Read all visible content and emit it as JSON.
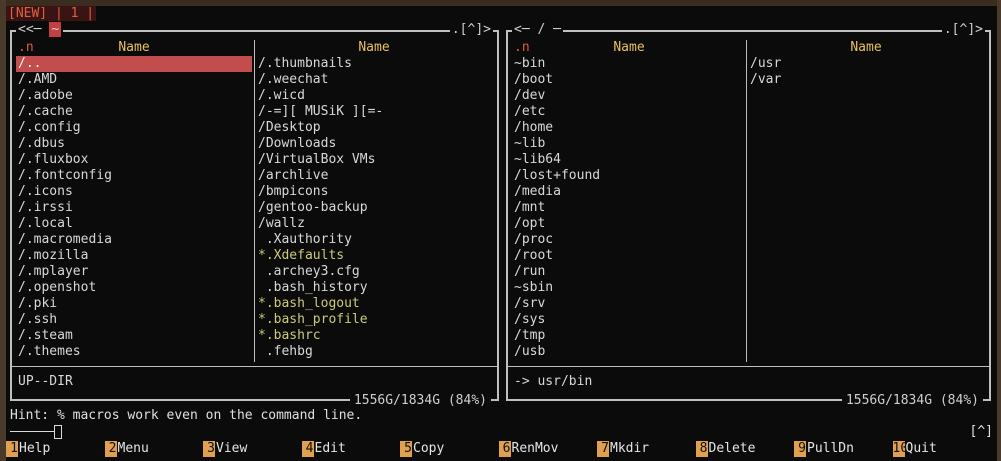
{
  "topbar": {
    "text": "[NEW] | 1 |"
  },
  "left_panel": {
    "path": "~",
    "corner": ".[^]>",
    "sort_indicator": ".n",
    "columns": [
      "Name",
      "Name"
    ],
    "col1": [
      "/..",
      "/.AMD",
      "/.adobe",
      "/.cache",
      "/.config",
      "/.dbus",
      "/.fluxbox",
      "/.fontconfig",
      "/.icons",
      "/.irssi",
      "/.local",
      "/.macromedia",
      "/.mozilla",
      "/.mplayer",
      "/.openshot",
      "/.pki",
      "/.ssh",
      "/.steam",
      "/.themes"
    ],
    "col2": [
      "/.thumbnails",
      "/.weechat",
      "/.wicd",
      "/-=][ MUSiK ][=-",
      "/Desktop",
      "/Downloads",
      "/VirtualBox VMs",
      "/archlive",
      "/bmpicons",
      "/gentoo-backup",
      "/wallz",
      " .Xauthority",
      "*.Xdefaults",
      " .archey3.cfg",
      " .bash_history",
      "*.bash_logout",
      "*.bash_profile",
      "*.bashrc",
      " .fehbg"
    ],
    "status": "UP--DIR",
    "free": "1556G/1834G (84%)"
  },
  "right_panel": {
    "path": "/",
    "corner": ".[^]>",
    "sort_indicator": ".n",
    "columns": [
      "Name",
      "Name"
    ],
    "col1": [
      "~bin",
      "/boot",
      "/dev",
      "/etc",
      "/home",
      "~lib",
      "~lib64",
      "/lost+found",
      "/media",
      "/mnt",
      "/opt",
      "/proc",
      "/root",
      "/run",
      "~sbin",
      "/srv",
      "/sys",
      "/tmp",
      "/usb"
    ],
    "col2": [
      "/usr",
      "/var"
    ],
    "status": "-> usr/bin",
    "free": "1556G/1834G (84%)"
  },
  "hint": "Hint: % macros work even on the command line.",
  "term_corner": "[^]",
  "fkeys": [
    {
      "num": "1",
      "label": "Help"
    },
    {
      "num": "2",
      "label": "Menu"
    },
    {
      "num": "3",
      "label": "View"
    },
    {
      "num": "4",
      "label": "Edit"
    },
    {
      "num": "5",
      "label": "Copy"
    },
    {
      "num": "6",
      "label": "RenMov"
    },
    {
      "num": "7",
      "label": "Mkdir"
    },
    {
      "num": "8",
      "label": "Delete"
    },
    {
      "num": "9",
      "label": "PullDn"
    },
    {
      "num": "10",
      "label": "Quit"
    }
  ]
}
